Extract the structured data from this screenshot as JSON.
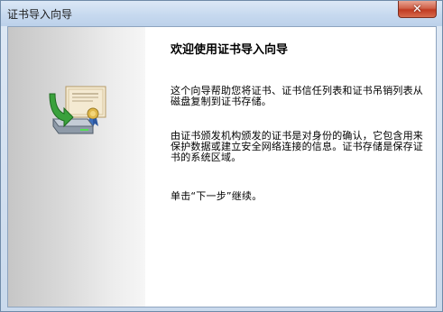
{
  "window": {
    "title": "证书导入向导"
  },
  "icons": {
    "close": "close-icon",
    "wizard": "certificate-import-icon"
  },
  "content": {
    "heading": "欢迎使用证书导入向导",
    "paragraph1": "这个向导帮助您将证书、证书信任列表和证书吊销列表从磁盘复制到证书存储。",
    "paragraph2": "由证书颁发机构颁发的证书是对身份的确认，它包含用来保护数据或建立安全网络连接的信息。证书存储是保存证书的系统区域。",
    "paragraph3": "单击“下一步”继续。"
  },
  "colors": {
    "close_button": "#c8412a",
    "titlebar": "#c7d9ef"
  }
}
